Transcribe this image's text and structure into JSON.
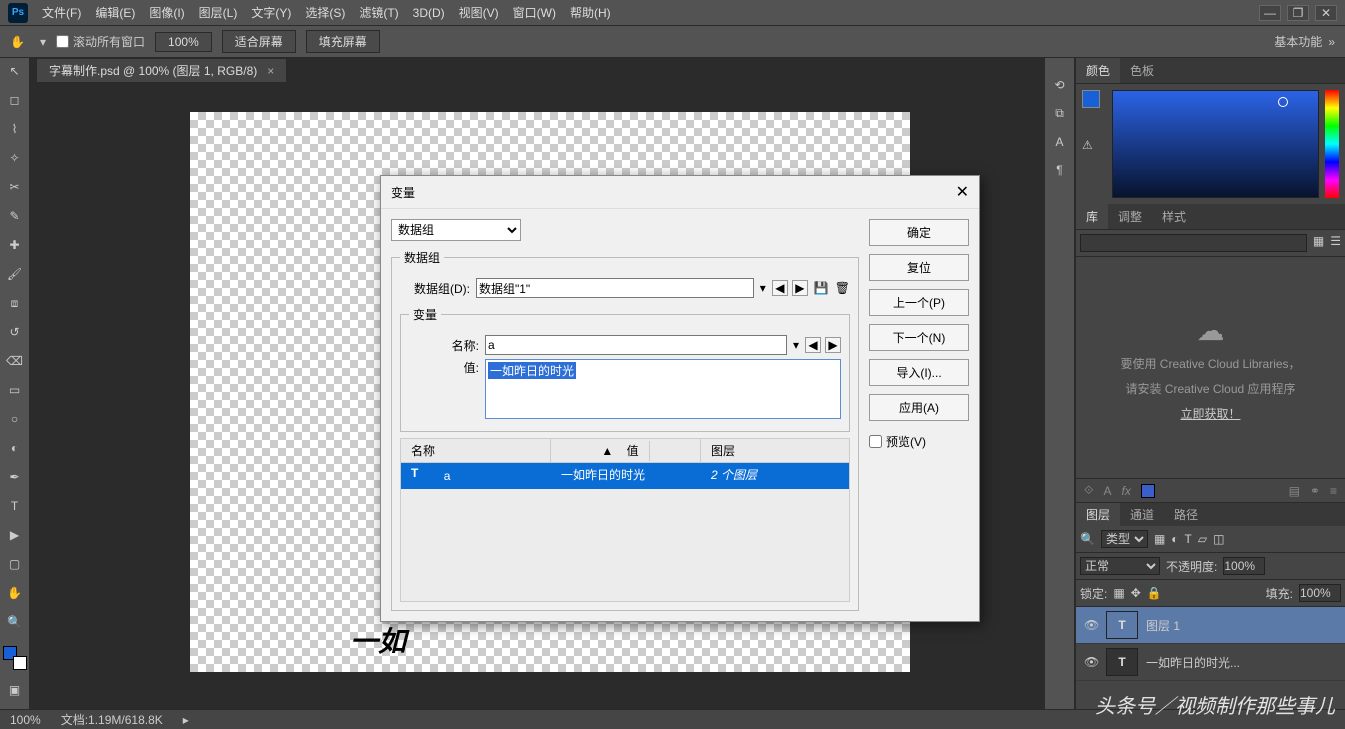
{
  "menubar": {
    "items": [
      "文件(F)",
      "编辑(E)",
      "图像(I)",
      "图层(L)",
      "文字(Y)",
      "选择(S)",
      "滤镜(T)",
      "3D(D)",
      "视图(V)",
      "窗口(W)",
      "帮助(H)"
    ]
  },
  "optbar": {
    "scroll_all": "滚动所有窗口",
    "zoom": "100%",
    "fit": "适合屏幕",
    "fill": "填充屏幕",
    "wslabel": "基本功能"
  },
  "tab": {
    "title": "字幕制作.psd @ 100% (图层 1, RGB/8)"
  },
  "canvas": {
    "glyphtext": "一如"
  },
  "panels": {
    "color_tabs": [
      "颜色",
      "色板"
    ],
    "lib_tabs": [
      "库",
      "调整",
      "样式"
    ],
    "lib_msg1": "要使用 Creative Cloud Libraries，",
    "lib_msg2": "请安装 Creative Cloud 应用程序",
    "lib_link": "立即获取！",
    "layer_tabs": [
      "图层",
      "通道",
      "路径"
    ],
    "kind": "类型",
    "blend": "正常",
    "opacity_l": "不透明度:",
    "opacity_v": "100%",
    "lock_l": "锁定:",
    "fill_l": "填充:",
    "fill_v": "100%",
    "layers": [
      {
        "name": "图层 1",
        "icon": "T",
        "sel": true
      },
      {
        "name": "一如昨日的时光...",
        "icon": "T",
        "sel": false
      }
    ]
  },
  "dialog": {
    "title": "变量",
    "topselect": "数据组",
    "grp_legend": "数据组",
    "grp_label": "数据组(D):",
    "grp_value": "数据组\"1\"",
    "var_legend": "变量",
    "name_label": "名称:",
    "name_value": "a",
    "value_label": "值:",
    "value_text": "一如昨日的时光",
    "tbl": {
      "h1": "名称",
      "h2": "值",
      "h3": "图层",
      "r_icon": "T",
      "r_name": "a",
      "r_val": "一如昨日的时光",
      "r_layer": "2 个图层"
    },
    "btns": {
      "ok": "确定",
      "reset": "复位",
      "prev": "上一个(P)",
      "next": "下一个(N)",
      "import": "导入(I)...",
      "apply": "应用(A)",
      "preview": "预览(V)"
    }
  },
  "status": {
    "zoom": "100%",
    "docinfo": "文档:1.19M/618.8K"
  },
  "watermark": "头条号／视频制作那些事儿"
}
